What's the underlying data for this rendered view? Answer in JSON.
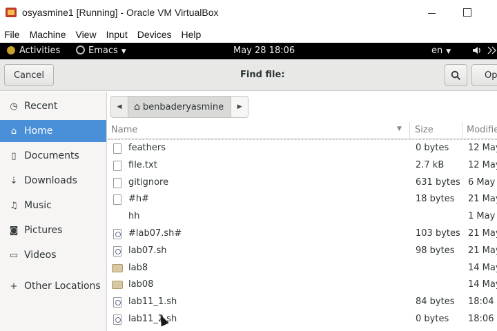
{
  "window": {
    "title": "osyasmine1 [Running] - Oracle VM VirtualBox",
    "menu": [
      "File",
      "Machine",
      "View",
      "Input",
      "Devices",
      "Help"
    ]
  },
  "topbar": {
    "activities": "Activities",
    "app": "Emacs",
    "clock": "May 28  18:06",
    "lang": "en"
  },
  "dialog": {
    "cancel_label": "Cancel",
    "title": "Find file:",
    "open_label": "Op"
  },
  "sidebar": {
    "items": [
      {
        "label": "Recent",
        "icon": "clock-icon"
      },
      {
        "label": "Home",
        "icon": "home-icon"
      },
      {
        "label": "Documents",
        "icon": "document-icon"
      },
      {
        "label": "Downloads",
        "icon": "download-icon"
      },
      {
        "label": "Music",
        "icon": "music-icon"
      },
      {
        "label": "Pictures",
        "icon": "camera-icon"
      },
      {
        "label": "Videos",
        "icon": "video-icon"
      },
      {
        "label": "Other Locations",
        "icon": "plus-icon"
      }
    ]
  },
  "pathbar": {
    "crumb": "benbaderyasmine"
  },
  "columns": {
    "name": "Name",
    "size": "Size",
    "modified": "Modifie"
  },
  "files": [
    {
      "name": "feathers",
      "size": "0 bytes",
      "modified": "12 May",
      "type": "file"
    },
    {
      "name": "file.txt",
      "size": "2.7 kB",
      "modified": "12 May",
      "type": "file"
    },
    {
      "name": "gitignore",
      "size": "631 bytes",
      "modified": "6 May",
      "type": "file"
    },
    {
      "name": "#h#",
      "size": "18 bytes",
      "modified": "21 May",
      "type": "file"
    },
    {
      "name": "hh",
      "size": "",
      "modified": "1 May",
      "type": "none"
    },
    {
      "name": "#lab07.sh#",
      "size": "103 bytes",
      "modified": "21 May",
      "type": "script"
    },
    {
      "name": "lab07.sh",
      "size": "98 bytes",
      "modified": "21 May",
      "type": "script"
    },
    {
      "name": "lab8",
      "size": "",
      "modified": "14 May",
      "type": "folder"
    },
    {
      "name": "lab08",
      "size": "",
      "modified": "14 May",
      "type": "folder"
    },
    {
      "name": "lab11_1.sh",
      "size": "84 bytes",
      "modified": "18:04",
      "type": "script"
    },
    {
      "name": "lab11_2.sh",
      "size": "0 bytes",
      "modified": "18:06",
      "type": "script"
    }
  ]
}
